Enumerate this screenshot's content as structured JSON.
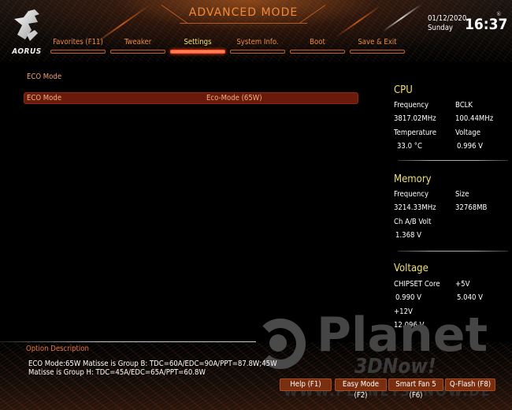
{
  "header": {
    "brand": "AORUS",
    "mode_title": "ADVANCED MODE",
    "date": "01/12/2020",
    "day": "Sunday",
    "time": "16:37",
    "registered_mark": "®"
  },
  "tabs": [
    {
      "label": "Favorites (F11)",
      "active": false
    },
    {
      "label": "Tweaker",
      "active": false
    },
    {
      "label": "Settings",
      "active": true
    },
    {
      "label": "System Info.",
      "active": false
    },
    {
      "label": "Boot",
      "active": false
    },
    {
      "label": "Save & Exit",
      "active": false
    }
  ],
  "main": {
    "section_label": "ECO Mode",
    "setting": {
      "name": "ECO Mode",
      "value": "Eco-Mode (65W)"
    }
  },
  "status": {
    "cpu": {
      "title": "CPU",
      "frequency_label": "Frequency",
      "frequency": "3817.02MHz",
      "bclk_label": "BCLK",
      "bclk": "100.44MHz",
      "temperature_label": "Temperature",
      "temperature": "33.0 °C",
      "voltage_label": "Voltage",
      "voltage": "0.996 V"
    },
    "memory": {
      "title": "Memory",
      "frequency_label": "Frequency",
      "frequency": "3214.33MHz",
      "size_label": "Size",
      "size": "32768MB",
      "volt_label": "Ch A/B Volt",
      "volt": "1.368 V"
    },
    "voltage": {
      "title": "Voltage",
      "chipset_label": "CHIPSET Core",
      "chipset": "0.990 V",
      "v5_label": "+5V",
      "v5": "5.040 V",
      "v12_label": "+12V",
      "v12": "12.096 V"
    }
  },
  "description": {
    "title": "Option Description",
    "lines": [
      "ECO Mode:65W Matisse is Group B: TDC=60A/EDC=90A/PPT=87.8W;45W",
      "Matisse is Group H: TDC=45A/EDC=65A/PPT=60.8W"
    ]
  },
  "footer_buttons": [
    {
      "label": "Help (F1)"
    },
    {
      "label": "Easy Mode (F2)"
    },
    {
      "label": "Smart Fan 5 (F6)"
    },
    {
      "label": "Q-Flash (F8)"
    }
  ],
  "watermark": {
    "brand": "Planet",
    "sub": "3DNow!",
    "url": "WWW.PLANET3DNOW.DE"
  },
  "colors": {
    "accent_orange": "#e88c4a",
    "active_tab_text": "#f0e070",
    "panel_title": "#f0e070",
    "selected_row_bg": "#6a1a0a",
    "footer_button_bg": "#7a2e10"
  }
}
